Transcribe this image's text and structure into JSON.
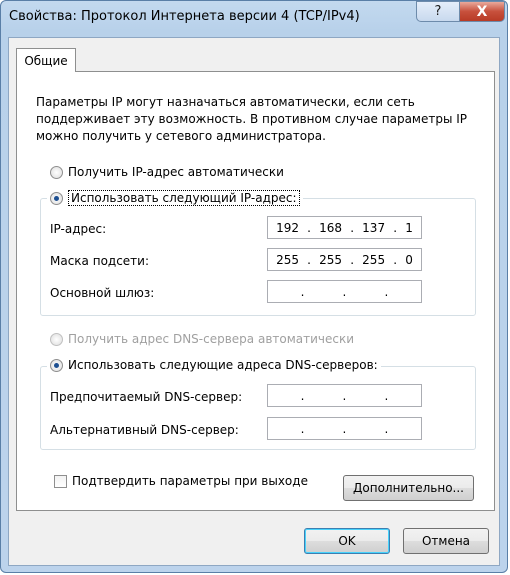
{
  "window": {
    "title": "Свойства: Протокол Интернета версии 4 (TCP/IPv4)",
    "help_label": "?",
    "close_label": "X"
  },
  "tabs": [
    {
      "label": "Общие",
      "selected": true
    }
  ],
  "description": "Параметры IP могут назначаться автоматически, если сеть поддерживает эту возможность. В противном случае параметры IP можно получить у сетевого администратора.",
  "ip_section": {
    "auto_radio": {
      "label": "Получить IP-адрес автоматически",
      "checked": false
    },
    "manual_radio": {
      "label": "Использовать следующий IP-адрес:",
      "checked": true
    },
    "fields": [
      {
        "label": "IP-адрес:",
        "octets": [
          "192",
          "168",
          "137",
          "1"
        ]
      },
      {
        "label": "Маска подсети:",
        "octets": [
          "255",
          "255",
          "255",
          "0"
        ]
      },
      {
        "label": "Основной шлюз:",
        "octets": [
          "",
          "",
          "",
          ""
        ]
      }
    ]
  },
  "dns_section": {
    "auto_radio": {
      "label": "Получить адрес DNS-сервера автоматически",
      "checked": false,
      "disabled": true
    },
    "manual_radio": {
      "label": "Использовать следующие адреса DNS-серверов:",
      "checked": true
    },
    "fields": [
      {
        "label": "Предпочитаемый DNS-сервер:",
        "octets": [
          "",
          "",
          "",
          ""
        ]
      },
      {
        "label": "Альтернативный DNS-сервер:",
        "octets": [
          "",
          "",
          "",
          ""
        ]
      }
    ]
  },
  "validate_checkbox": {
    "label": "Подтвердить параметры при выходе",
    "checked": false
  },
  "buttons": {
    "advanced": "Дополнительно...",
    "ok": "OK",
    "cancel": "Отмена"
  }
}
